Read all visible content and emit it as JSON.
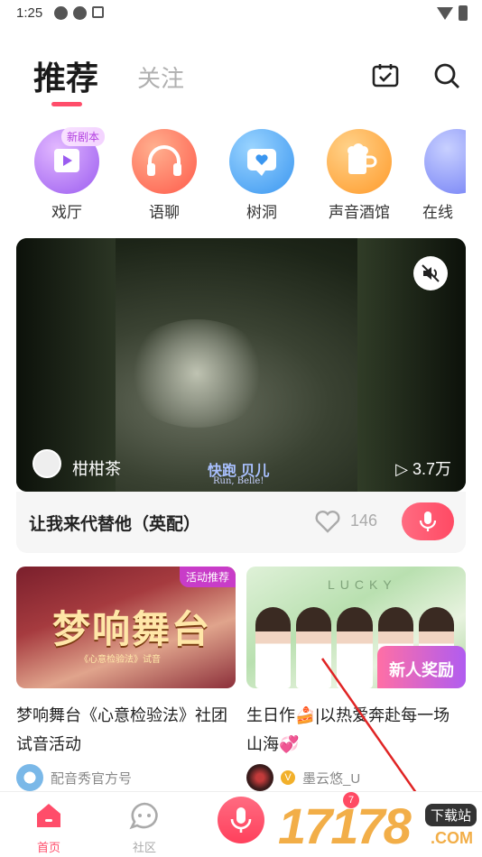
{
  "status": {
    "time": "1:25"
  },
  "header": {
    "tab_recommend": "推荐",
    "tab_follow": "关注"
  },
  "categories": [
    {
      "label": "戏厅",
      "badge": "新剧本",
      "color": "#b27cf5"
    },
    {
      "label": "语聊",
      "color": "#ff6a5a"
    },
    {
      "label": "树洞",
      "color": "#4aa8f0"
    },
    {
      "label": "声音酒馆",
      "color": "#ffa43a"
    },
    {
      "label": "在线",
      "color": "#7a8cff"
    }
  ],
  "video": {
    "username": "柑柑茶",
    "subtitle": "快跑 贝儿",
    "subtitle_en": "Run, Belle!",
    "plays": "▷ 3.7万",
    "title": "让我来代替他（英配）",
    "likes": "146"
  },
  "feed": [
    {
      "thumb_text": "梦响舞台",
      "thumb_sub": "《心意检验法》试音",
      "tag": "活动推荐",
      "title": "梦响舞台《心意检验法》社团试音活动",
      "author": "配音秀官方号"
    },
    {
      "thumb_text": "LUCKY",
      "gift_text": "新人奖励",
      "title": "生日作🍰|以热爱奔赴每一场山海💞",
      "author": "墨云悠_U"
    }
  ],
  "bottomnav": {
    "home": "首页",
    "community": "社区",
    "messages_badge": "7",
    "active_color": "#ff4d6a"
  },
  "watermark": {
    "num": "17178",
    "dl": "下载站",
    "com": ".COM"
  }
}
